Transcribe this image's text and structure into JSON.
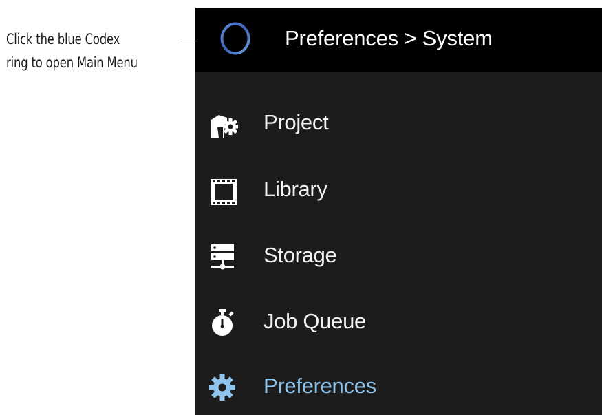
{
  "annotation": {
    "lines": [
      "Click the blue Codex",
      "ring to open Main Menu"
    ]
  },
  "header": {
    "title": "Preferences > System",
    "ring_icon": "codex-ring-icon",
    "ring_color": "#4a72c2"
  },
  "nav": {
    "items": [
      {
        "label": "Project",
        "icon": "project-gear-icon",
        "active": false
      },
      {
        "label": "Library",
        "icon": "film-strip-icon",
        "active": false
      },
      {
        "label": "Storage",
        "icon": "server-storage-icon",
        "active": false
      },
      {
        "label": "Job Queue",
        "icon": "stopwatch-icon",
        "active": false
      },
      {
        "label": "Preferences",
        "icon": "gear-icon",
        "active": true
      }
    ]
  },
  "colors": {
    "panel_bg": "#1c1c1c",
    "header_bg": "#000000",
    "icon_white": "#ffffff",
    "accent_blue": "#8fc5ec"
  }
}
